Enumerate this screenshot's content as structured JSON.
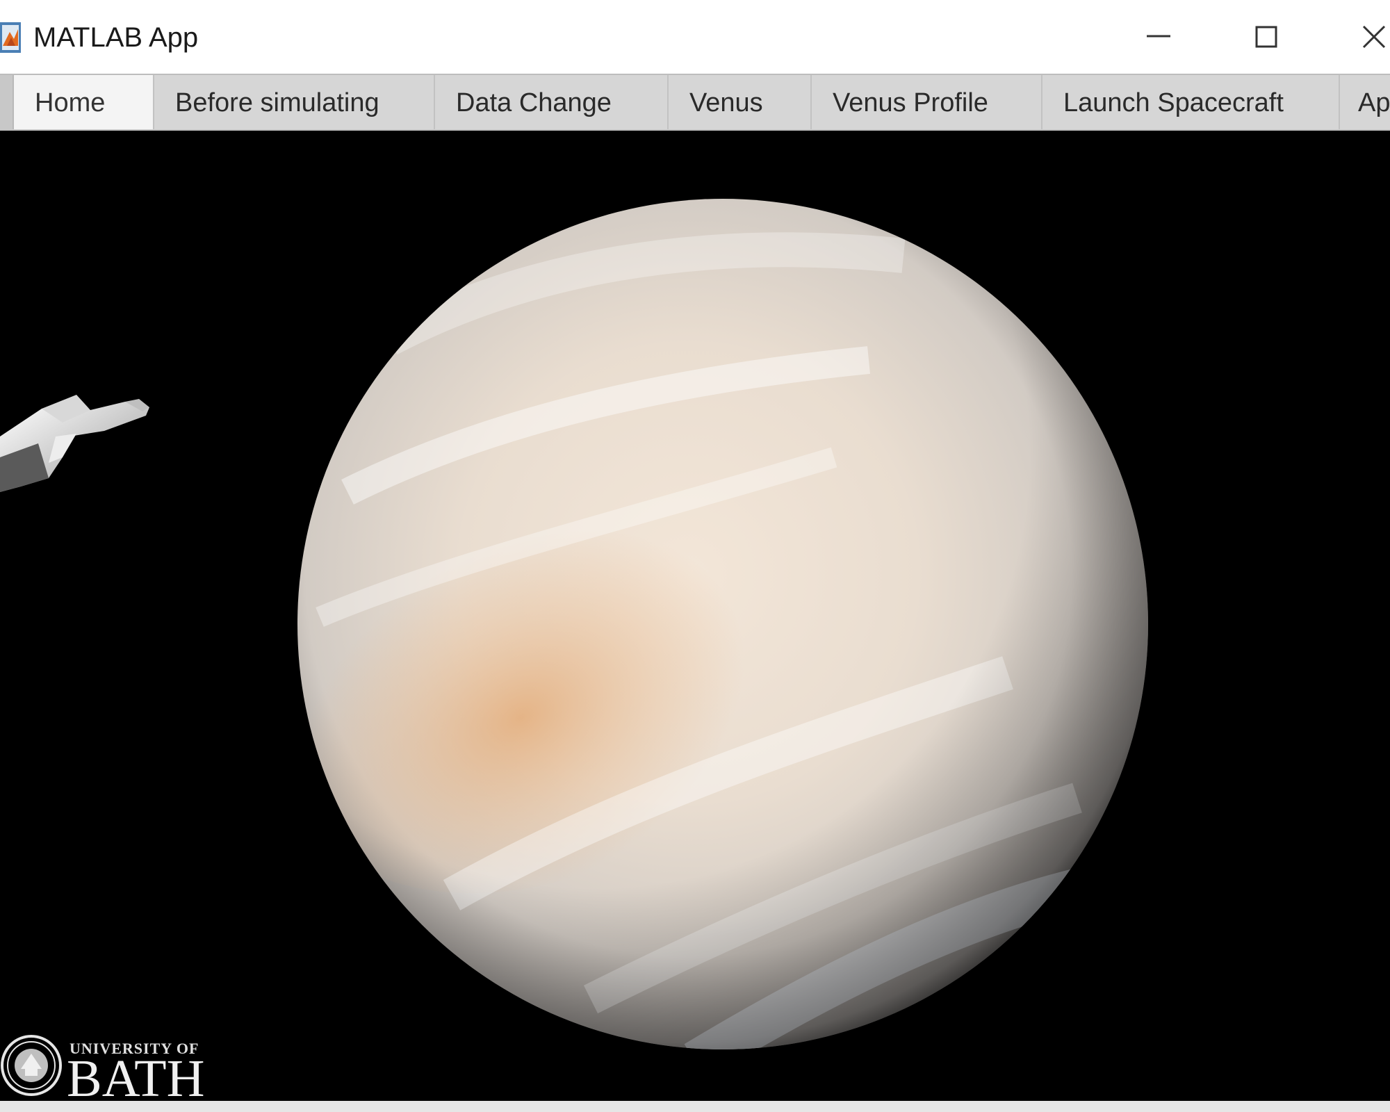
{
  "window": {
    "title": "MATLAB App",
    "controls": {
      "minimize_icon": "minimize-icon",
      "maximize_icon": "maximize-icon",
      "close_icon": "close-icon"
    }
  },
  "tabs": [
    {
      "label": "Home",
      "active": true
    },
    {
      "label": "Before simulating",
      "active": false
    },
    {
      "label": "Data Change",
      "active": false
    },
    {
      "label": "Venus",
      "active": false
    },
    {
      "label": "Venus Profile",
      "active": false
    },
    {
      "label": "Launch Spacecraft",
      "active": false
    },
    {
      "label": "Ap",
      "active": false
    }
  ],
  "home": {
    "image_subjects": [
      "spacecraft",
      "planet-venus"
    ],
    "logo": {
      "line1": "UNIVERSITY OF",
      "line2": "BATH"
    }
  },
  "colors": {
    "titlebar_bg": "#ffffff",
    "tab_bg": "#d6d6d6",
    "tab_active_bg": "#f4f4f4",
    "content_bg": "#000000"
  }
}
